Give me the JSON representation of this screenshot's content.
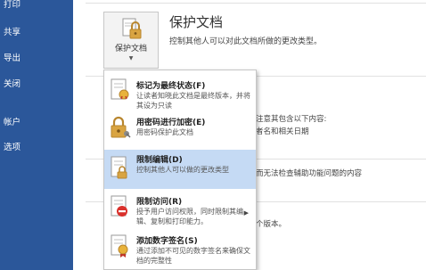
{
  "nav": {
    "items": [
      "打印",
      "共享",
      "导出",
      "关闭",
      "帐户",
      "选项"
    ]
  },
  "protect": {
    "button_label": "保护文档",
    "title": "保护文档",
    "description": "控制其他人可以对此文档所做的更改类型。"
  },
  "background": {
    "line1": "注意其包含以下内容:",
    "line2": "者名和相关日期",
    "line3": "而无法检查辅助功能问题的内容",
    "line4": "个版本。"
  },
  "menu": {
    "items": [
      {
        "title": "标记为最终状态(F)",
        "desc": "让读者知晓此文档是最终版本，并将其设为只读",
        "icon": "final-document-icon",
        "selected": false,
        "has_submenu": false
      },
      {
        "title": "用密码进行加密(E)",
        "desc": "用密码保护此文档",
        "icon": "lock-key-icon",
        "selected": false,
        "has_submenu": false
      },
      {
        "title": "限制编辑(D)",
        "desc": "控制其他人可以做的更改类型",
        "icon": "restrict-editing-icon",
        "selected": true,
        "has_submenu": false
      },
      {
        "title": "限制访问(R)",
        "desc": "授予用户访问权限，同时限制其编辑、复制和打印能力。",
        "icon": "restrict-access-icon",
        "selected": false,
        "has_submenu": true
      },
      {
        "title": "添加数字签名(S)",
        "desc": "通过添加不可见的数字签名来确保文档的完整性",
        "icon": "digital-signature-icon",
        "selected": false,
        "has_submenu": false
      }
    ]
  },
  "colors": {
    "nav_bg": "#2b579a",
    "selected_bg": "#c5daf4",
    "lock_gold": "#d9a441"
  }
}
